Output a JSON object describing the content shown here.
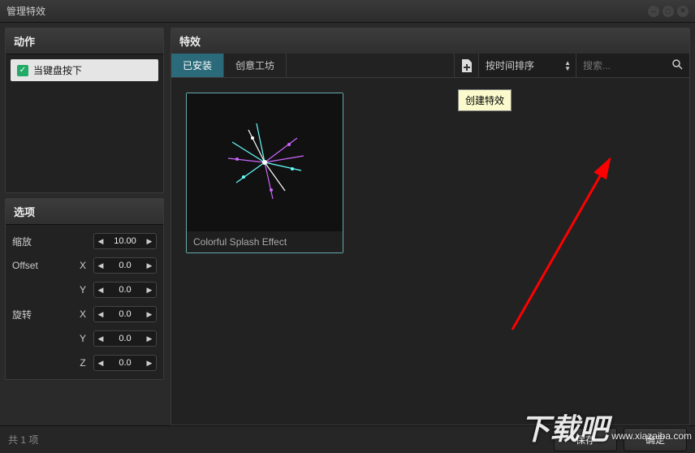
{
  "title": "管理特效",
  "left": {
    "actions_title": "动作",
    "action_item": "当键盘按下",
    "options_title": "选项",
    "zoom_label": "缩放",
    "zoom_value": "10.00",
    "offset_label": "Offset",
    "rotate_label": "旋转",
    "axes": {
      "x": "X",
      "y": "Y",
      "z": "Z"
    },
    "zero": "0.0"
  },
  "fx": {
    "title": "特效",
    "tab_installed": "已安装",
    "tab_workshop": "创意工坊",
    "sort_label": "按时间排序",
    "search_placeholder": "搜索...",
    "card_name": "Colorful Splash Effect"
  },
  "tooltip": "创建特效",
  "footer": {
    "count": "共 1 项",
    "save": "保存",
    "ok": "确定"
  },
  "watermark": {
    "big": "下载吧",
    "small": "www.xiazaiba.com"
  }
}
